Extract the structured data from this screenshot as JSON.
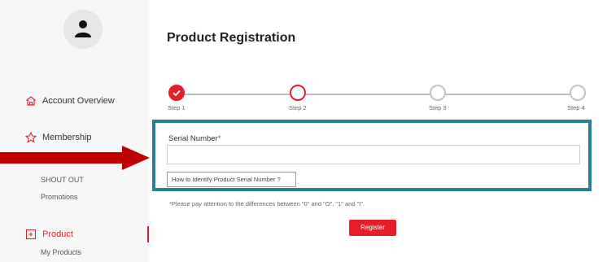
{
  "sidebar": {
    "items": [
      {
        "label": "Account Overview",
        "icon": "home-icon"
      },
      {
        "label": "Membership",
        "icon": "star-icon"
      },
      {
        "label": "SHOUT OUT"
      },
      {
        "label": "Promotions"
      },
      {
        "label": "Product",
        "icon": "product-icon"
      },
      {
        "label": "My Products"
      }
    ]
  },
  "main": {
    "title": "Product Registration",
    "steps": [
      {
        "label": "Step 1",
        "state": "complete"
      },
      {
        "label": "Step 2",
        "state": "current"
      },
      {
        "label": "Step 3",
        "state": "todo"
      },
      {
        "label": "Step 4",
        "state": "todo"
      }
    ],
    "serial": {
      "label": "Serial Number",
      "required_mark": "*",
      "value": "",
      "placeholder": ""
    },
    "help_button": "How to Identify Product Serial Number ?",
    "note": "*Please pay attention to the differences between \"0\" and \"O\", \"1\" and \"I\".",
    "register_button": "Register"
  },
  "colors": {
    "accent": "#e51e2a",
    "highlight_box": "#2c7f91",
    "annotation_arrow": "#c00000"
  }
}
